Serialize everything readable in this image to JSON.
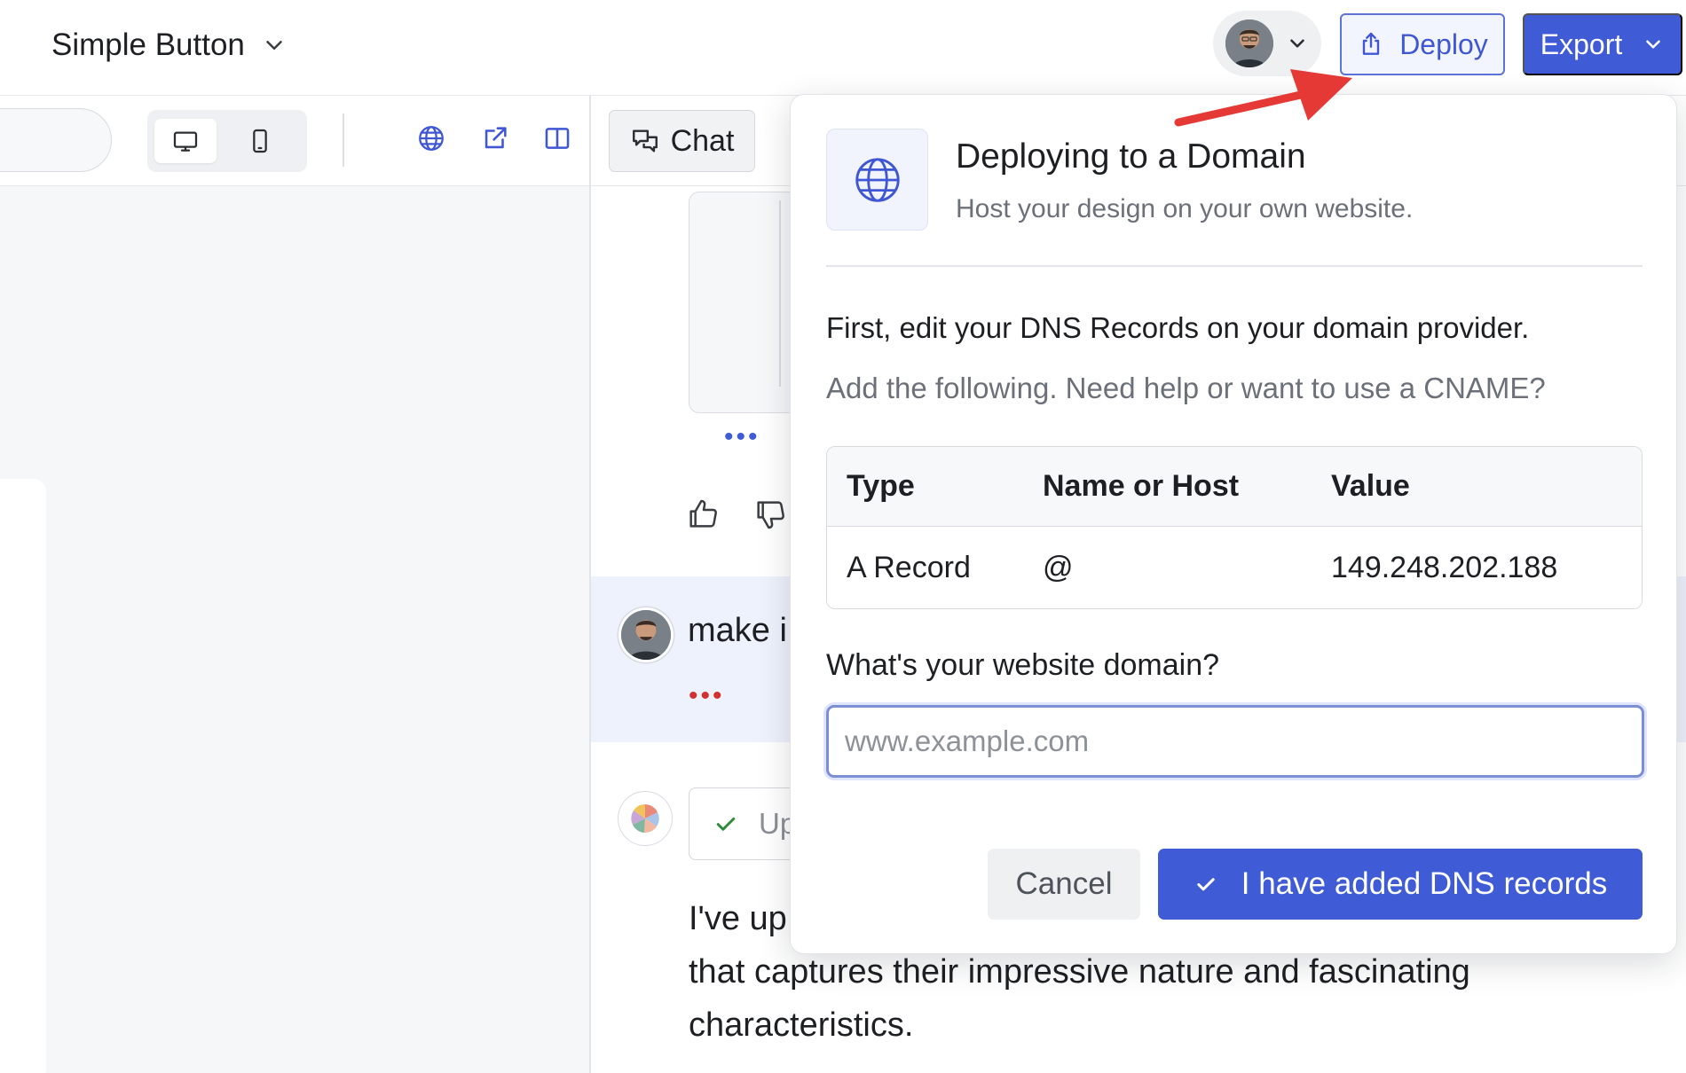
{
  "header": {
    "project_title": "Simple Button",
    "deploy_label": "Deploy",
    "export_label": "Export"
  },
  "toolbar": {
    "chat_tab_label": "Chat"
  },
  "chat": {
    "user_message_text": "make i",
    "status_chip_text": "Up",
    "ai_message_lines": [
      "I've up",
      "that captures their impressive nature and fascinating",
      "characteristics."
    ]
  },
  "deploy_popover": {
    "title": "Deploying to a Domain",
    "subtitle": "Host your design on your own website.",
    "step_heading": "First, edit your DNS Records on your domain provider.",
    "step_help": "Add the following. Need help or want to use a CNAME?",
    "table": {
      "headers": [
        "Type",
        "Name or Host",
        "Value"
      ],
      "rows": [
        [
          "A Record",
          "@",
          "149.248.202.188"
        ]
      ]
    },
    "domain_label": "What's your website domain?",
    "domain_placeholder": "www.example.com",
    "cancel_label": "Cancel",
    "confirm_label": "I have added DNS records"
  },
  "colors": {
    "accent": "#3f5bd6",
    "annotation_arrow": "#e53935",
    "user_message_bg": "#eef2fc"
  },
  "icons": [
    "chevron-down-icon",
    "share-upload-icon",
    "desktop-icon",
    "mobile-icon",
    "globe-icon",
    "external-link-icon",
    "split-view-icon",
    "chat-bubbles-icon",
    "thumbs-up-icon",
    "thumbs-down-icon",
    "check-icon"
  ]
}
